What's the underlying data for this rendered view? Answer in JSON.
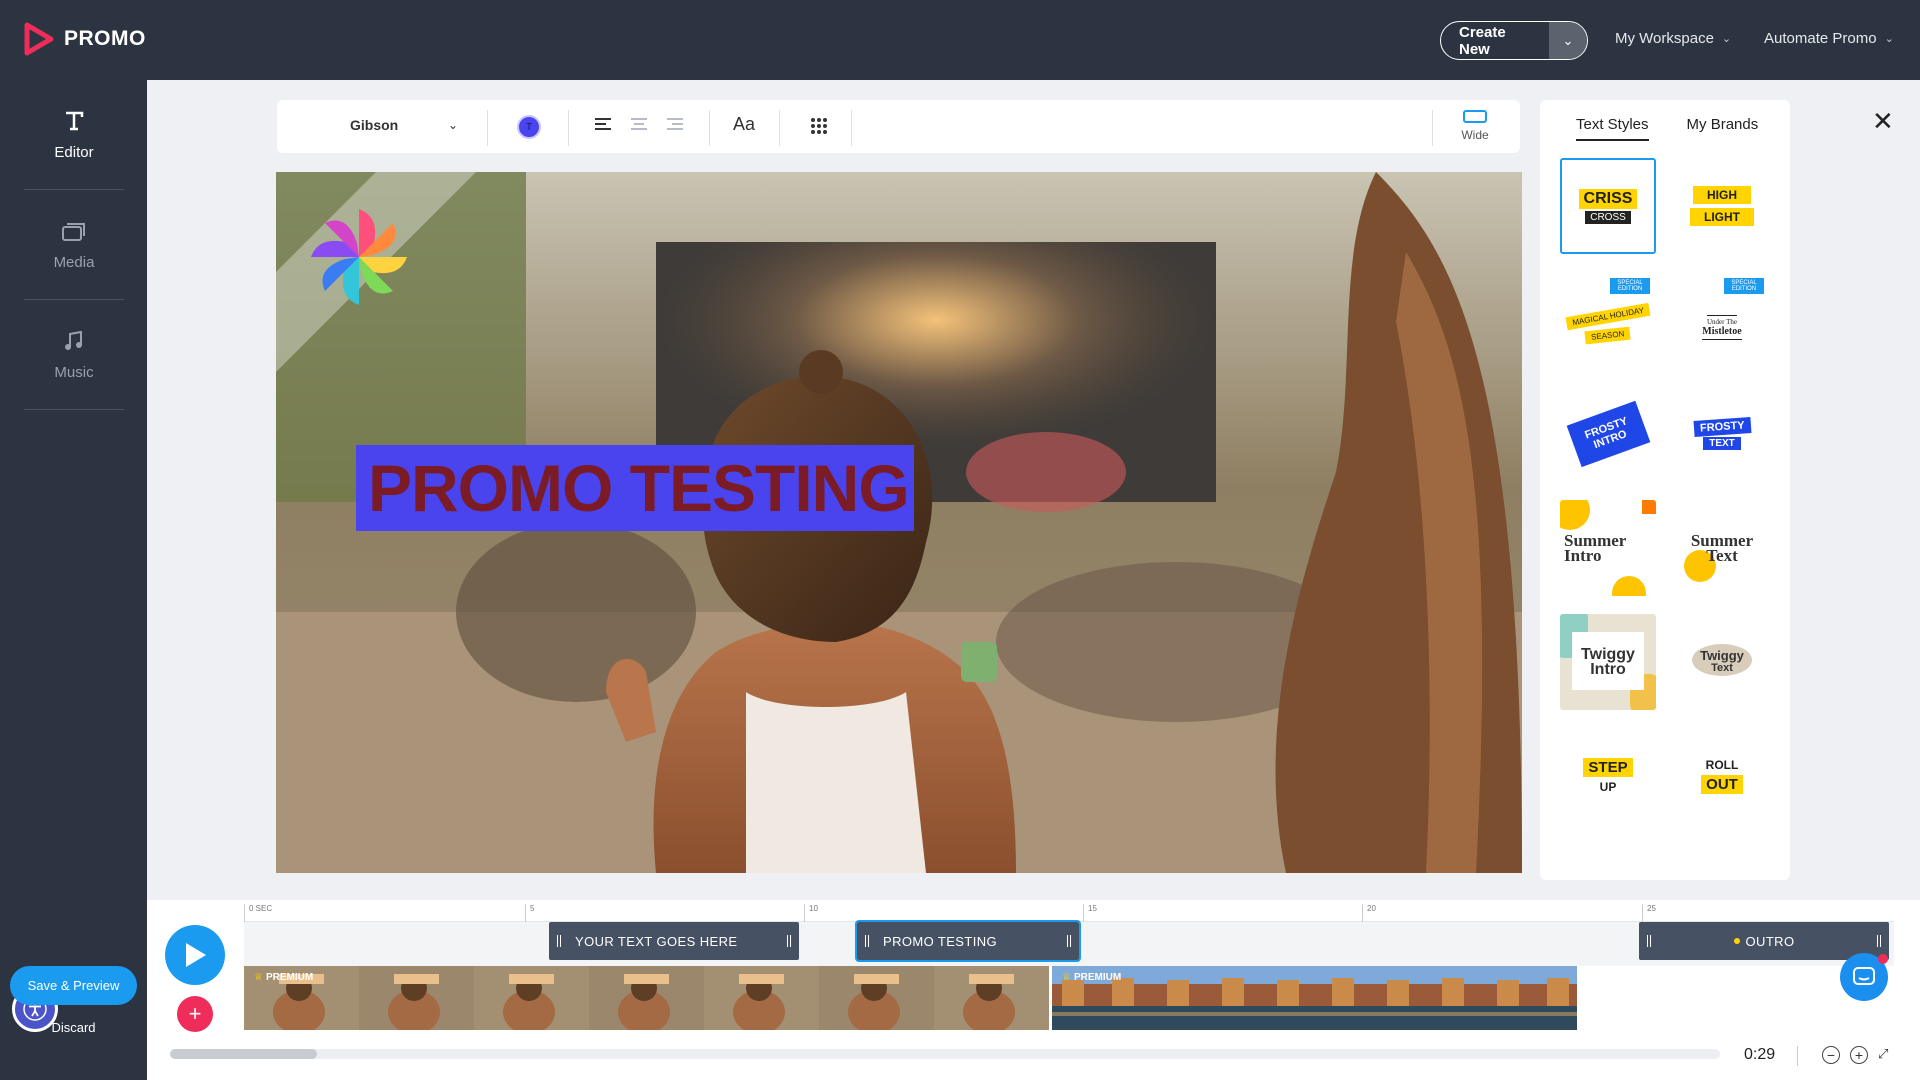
{
  "brand": {
    "name": "PROMO"
  },
  "header": {
    "create_new": "Create New",
    "workspace": "My Workspace",
    "automate": "Automate Promo"
  },
  "sidebar": {
    "items": [
      {
        "label": "Editor",
        "icon": "text-t-icon"
      },
      {
        "label": "Media",
        "icon": "media-stack-icon"
      },
      {
        "label": "Music",
        "icon": "music-note-icon"
      }
    ],
    "save_preview": "Save & Preview",
    "discard": "Discard"
  },
  "toolbar": {
    "font": "Gibson",
    "color_label": "T",
    "text_color": "#4a44ef",
    "case_label": "Aa",
    "aspect": "Wide"
  },
  "canvas": {
    "headline": "PROMO TESTING",
    "headline_bg": "#4a44ef",
    "headline_color": "#7a1b26"
  },
  "styles_panel": {
    "tabs": [
      "Text Styles",
      "My Brands"
    ],
    "tiles": [
      {
        "line1": "CRISS",
        "line2": "CROSS"
      },
      {
        "line1": "HIGH",
        "line2": "LIGHT"
      },
      {
        "line1": "MAGICAL HOLIDAY",
        "line2": "SEASON",
        "badge": "SPECIAL EDITION"
      },
      {
        "line1": "Under The",
        "line2": "Mistletoe",
        "badge": "SPECIAL EDITION"
      },
      {
        "line1": "FROSTY",
        "line2": "INTRO"
      },
      {
        "line1": "FROSTY",
        "line2": "TEXT"
      },
      {
        "line1": "Summer",
        "line2": "Intro"
      },
      {
        "line1": "Summer",
        "line2": "Text"
      },
      {
        "line1": "Twiggy",
        "line2": "Intro"
      },
      {
        "line1": "Twiggy",
        "line2": "Text"
      },
      {
        "line1": "STEP",
        "line2": "UP"
      },
      {
        "line1": "ROLL",
        "line2": "OUT"
      }
    ]
  },
  "timeline": {
    "ruler": [
      "0 SEC",
      "5",
      "10",
      "15",
      "20",
      "25"
    ],
    "text_clips": [
      "YOUR TEXT GOES HERE",
      "PROMO TESTING",
      "OUTRO"
    ],
    "premium_label": "PREMIUM",
    "time": "0:29"
  },
  "colors": {
    "accent": "#1a9bf0",
    "dark": "#2c3441",
    "add": "#ee2d5a"
  }
}
